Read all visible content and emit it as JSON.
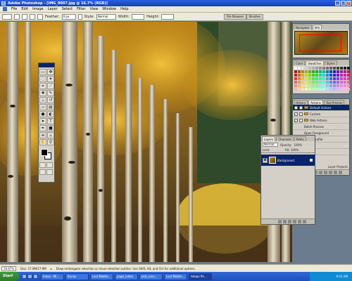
{
  "window": {
    "title": "Adobe Photoshop - [IMG_0007.jpg @ 16.7% (RGB)]"
  },
  "menu": {
    "items": [
      "File",
      "Edit",
      "Image",
      "Layer",
      "Select",
      "Filter",
      "View",
      "Window",
      "Help"
    ]
  },
  "options_bar": {
    "feather_label": "Feather:",
    "feather_value": "0 px",
    "style_label": "Style:",
    "style_value": "Normal",
    "width_label": "Width:",
    "height_label": "Height:",
    "file_browser": "File Browser",
    "brushes": "Brushes"
  },
  "panels": {
    "navigator": {
      "tabs": [
        "Navigator",
        "Info"
      ]
    },
    "swatches": {
      "tabs": [
        "Color",
        "Swatches",
        "Styles"
      ]
    },
    "actions": {
      "tabs": [
        "History",
        "Actions",
        "Tool Presets"
      ],
      "items": [
        "Default Actions",
        "Custom",
        "Web Actions",
        "Batch Process",
        "Open Foreground",
        "Action Profile",
        "Resize",
        "Sharp..."
      ],
      "footer": "Layer Projects"
    },
    "layers": {
      "tabs": [
        "Layers",
        "Channels",
        "Paths"
      ],
      "mode": "Normal",
      "opacity_label": "Opacity:",
      "opacity_value": "100%",
      "lock_label": "Lock:",
      "fill_label": "Fill:",
      "fill_value": "100%",
      "layer_name": "Background"
    }
  },
  "status": {
    "zoom": "16.67%",
    "doc": "Doc: 17.9M/17.9M",
    "hint": "Draw rectangular selection or move selection outline. Use Shift, Alt, and Ctrl for additional options."
  },
  "taskbar": {
    "start": "Start",
    "buttons": [
      "Inbox - Mi...",
      "Itunes",
      "Lost Mobile...",
      "page_index",
      "psd_conv...",
      "Lost Mobile...",
      "Adobe Ph..."
    ],
    "clock": "9:41 AM"
  },
  "colors": {
    "accent": "#0a246a",
    "title": "#1640b8",
    "foliage": "#d6a020"
  }
}
